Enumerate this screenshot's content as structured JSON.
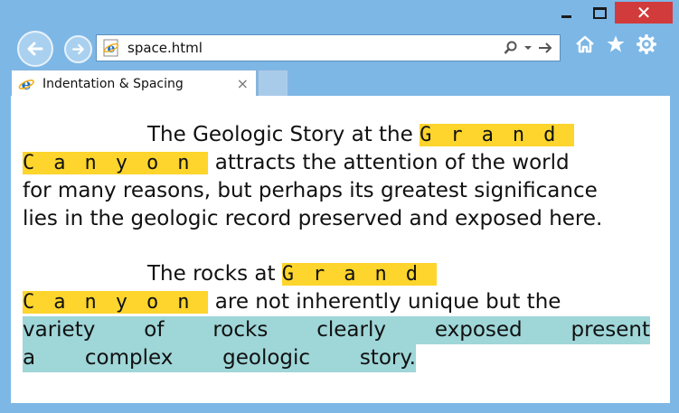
{
  "browser": {
    "url": "space.html",
    "tab_title": "Indentation & Spacing",
    "tab_close": "×",
    "close_glyph": "✕"
  },
  "content": {
    "para1": {
      "line1_text": "The Geologic Story at the",
      "highlight1": "Grand",
      "highlight2": "Canyon",
      "line2_rest": "attracts the attention of the world",
      "line3": "for many reasons, but perhaps its greatest significance",
      "line4": "lies in the geologic record preserved and exposed here."
    },
    "para2": {
      "line1_text": "The rocks at",
      "highlight1": "Grand",
      "highlight2": "Canyon",
      "line2_rest": "are not inherently unique but the",
      "line3_words": [
        "variety",
        "of",
        "rocks",
        "clearly",
        "exposed",
        "present"
      ],
      "line4_words": [
        "a",
        "complex",
        "geologic",
        "story."
      ]
    }
  },
  "colors": {
    "frame": "#7db7e6",
    "highlight_yellow": "#fdd52c",
    "highlight_teal": "#9fd6d8",
    "close_red": "#d23b3b"
  }
}
